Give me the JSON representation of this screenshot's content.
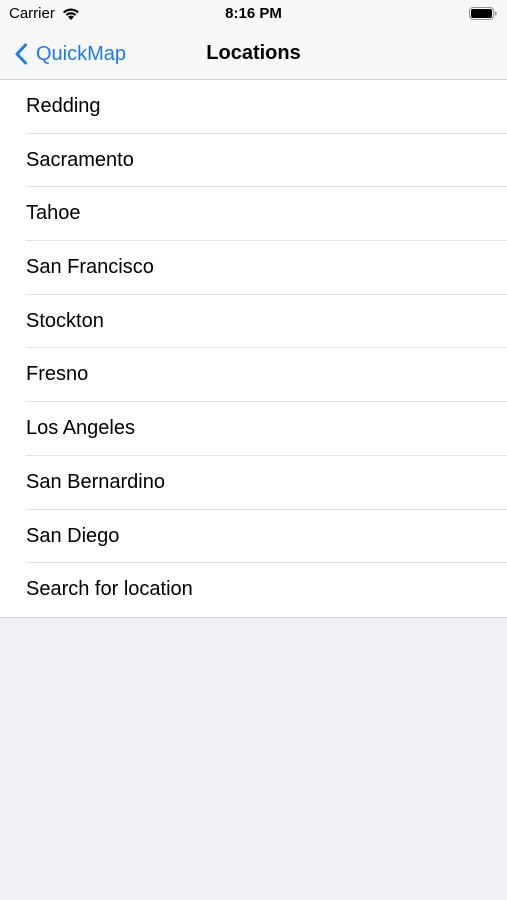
{
  "status_bar": {
    "carrier": "Carrier",
    "time": "8:16 PM",
    "wifi_icon": "wifi-icon",
    "battery_icon": "battery-icon"
  },
  "nav": {
    "back_label": "QuickMap",
    "back_icon": "chevron-left-icon",
    "title": "Locations",
    "accent_color": "#1E7CF2"
  },
  "locations": [
    {
      "label": "Redding"
    },
    {
      "label": "Sacramento"
    },
    {
      "label": "Tahoe"
    },
    {
      "label": "San Francisco"
    },
    {
      "label": "Stockton"
    },
    {
      "label": "Fresno"
    },
    {
      "label": "Los Angeles"
    },
    {
      "label": "San Bernardino"
    },
    {
      "label": "San Diego"
    },
    {
      "label": "Search for location"
    }
  ]
}
